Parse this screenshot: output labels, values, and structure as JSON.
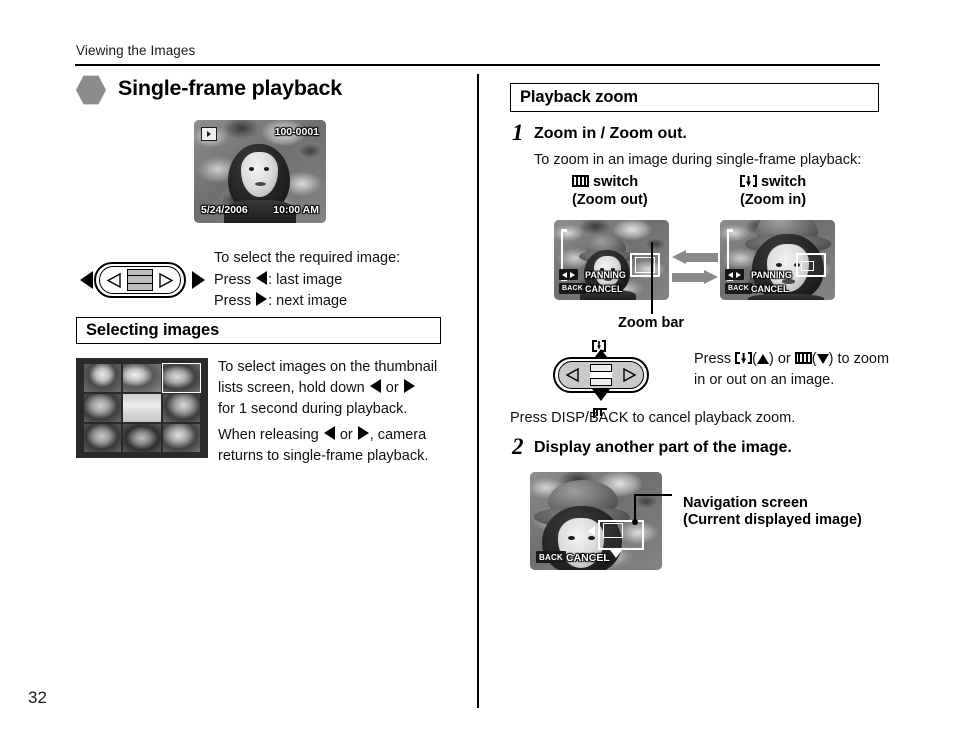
{
  "header": {
    "running_head": "Viewing the Images",
    "page_number": "32"
  },
  "left_column": {
    "section_title": "Single-frame playback",
    "lcd_preview": {
      "frame_number": "100-0001",
      "date": "5/24/2006",
      "time": "10:00 AM",
      "play_icon": "playback-icon"
    },
    "instructions": {
      "intro": "To select the required image:",
      "press_left_prefix": "Press",
      "press_left_suffix": ": last image",
      "press_right_prefix": "Press",
      "press_right_suffix": ": next image"
    },
    "selecting_images": {
      "title": "Selecting images",
      "paragraph1_part1": "To select images on the thumbnail",
      "paragraph1_part2": "lists screen, hold down",
      "paragraph1_or": "or",
      "paragraph1_part3": "for 1 second during playback.",
      "paragraph2_part1": "When releasing",
      "paragraph2_or": "or",
      "paragraph2_part2": ", camera",
      "paragraph2_part3": "returns to single-frame playback."
    }
  },
  "right_column": {
    "section_title": "Playback zoom",
    "step1": {
      "number": "1",
      "title": "Zoom in / Zoom out.",
      "lead": "To zoom in an image during single-frame playback:",
      "switch_left_label": "switch",
      "switch_left_sub": "(Zoom out)",
      "switch_right_label": "switch",
      "switch_right_sub": "(Zoom in)",
      "switch_left_icon": "zoom-wide-icon",
      "switch_right_icon": "zoom-tele-icon",
      "zoom_bar_caption": "Zoom bar",
      "osd_panning": "PANNING",
      "osd_cancel": "CANCEL",
      "osd_back": "BACK",
      "press_text_prefix": "Press",
      "press_text_mid": "or",
      "press_text_suffix": "to zoom",
      "press_text_line2": "in or out on an image.",
      "cancel_note": "Press DISP/BACK to cancel playback zoom."
    },
    "step2": {
      "number": "2",
      "title": "Display another part of the image.",
      "callout_line1": "Navigation screen",
      "callout_line2": "(Current displayed image)",
      "osd_cancel": "CANCEL",
      "osd_back": "BACK"
    }
  },
  "colors": {
    "rule": "#000000",
    "hex_bullet": "#8c8c8c",
    "gray_arrow": "#8a8a8a",
    "lcd_background": "#6d6d6d",
    "thumb_screen_bg": "#2a2a2a"
  }
}
